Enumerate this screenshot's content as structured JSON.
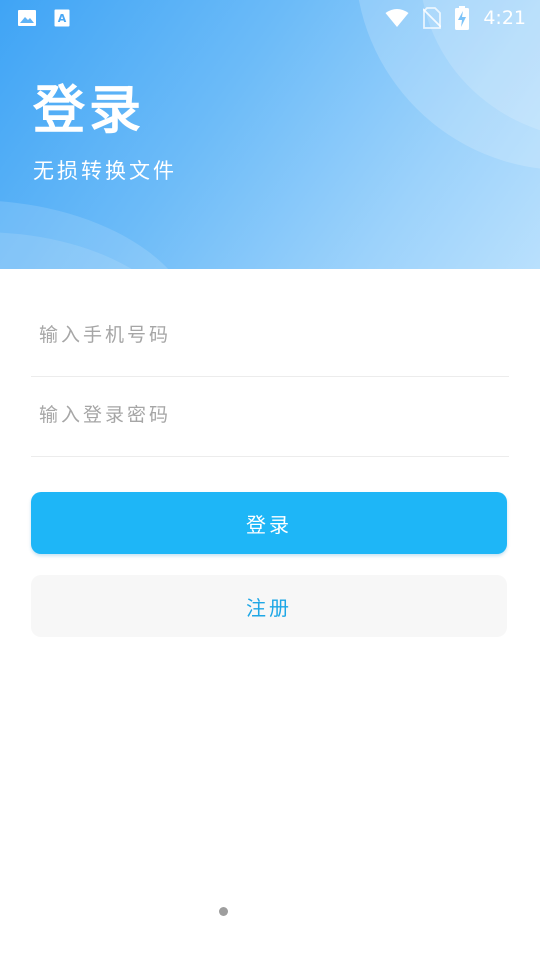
{
  "status_bar": {
    "time": "4:21",
    "icons": [
      "image-icon",
      "font-a-icon",
      "wifi-icon",
      "no-sim-icon",
      "battery-charging-icon"
    ],
    "notification_letter": "A"
  },
  "header": {
    "title": "登录",
    "subtitle": "无损转换文件"
  },
  "form": {
    "phone_placeholder": "输入手机号码",
    "phone_value": "",
    "password_placeholder": "输入登录密码",
    "password_value": ""
  },
  "buttons": {
    "login_label": "登录",
    "register_label": "注册"
  },
  "colors": {
    "accent": "#1eb6f7",
    "register_text": "#1ea7e6",
    "header_start": "#3fa4f5",
    "header_end": "#b9e0fd"
  }
}
